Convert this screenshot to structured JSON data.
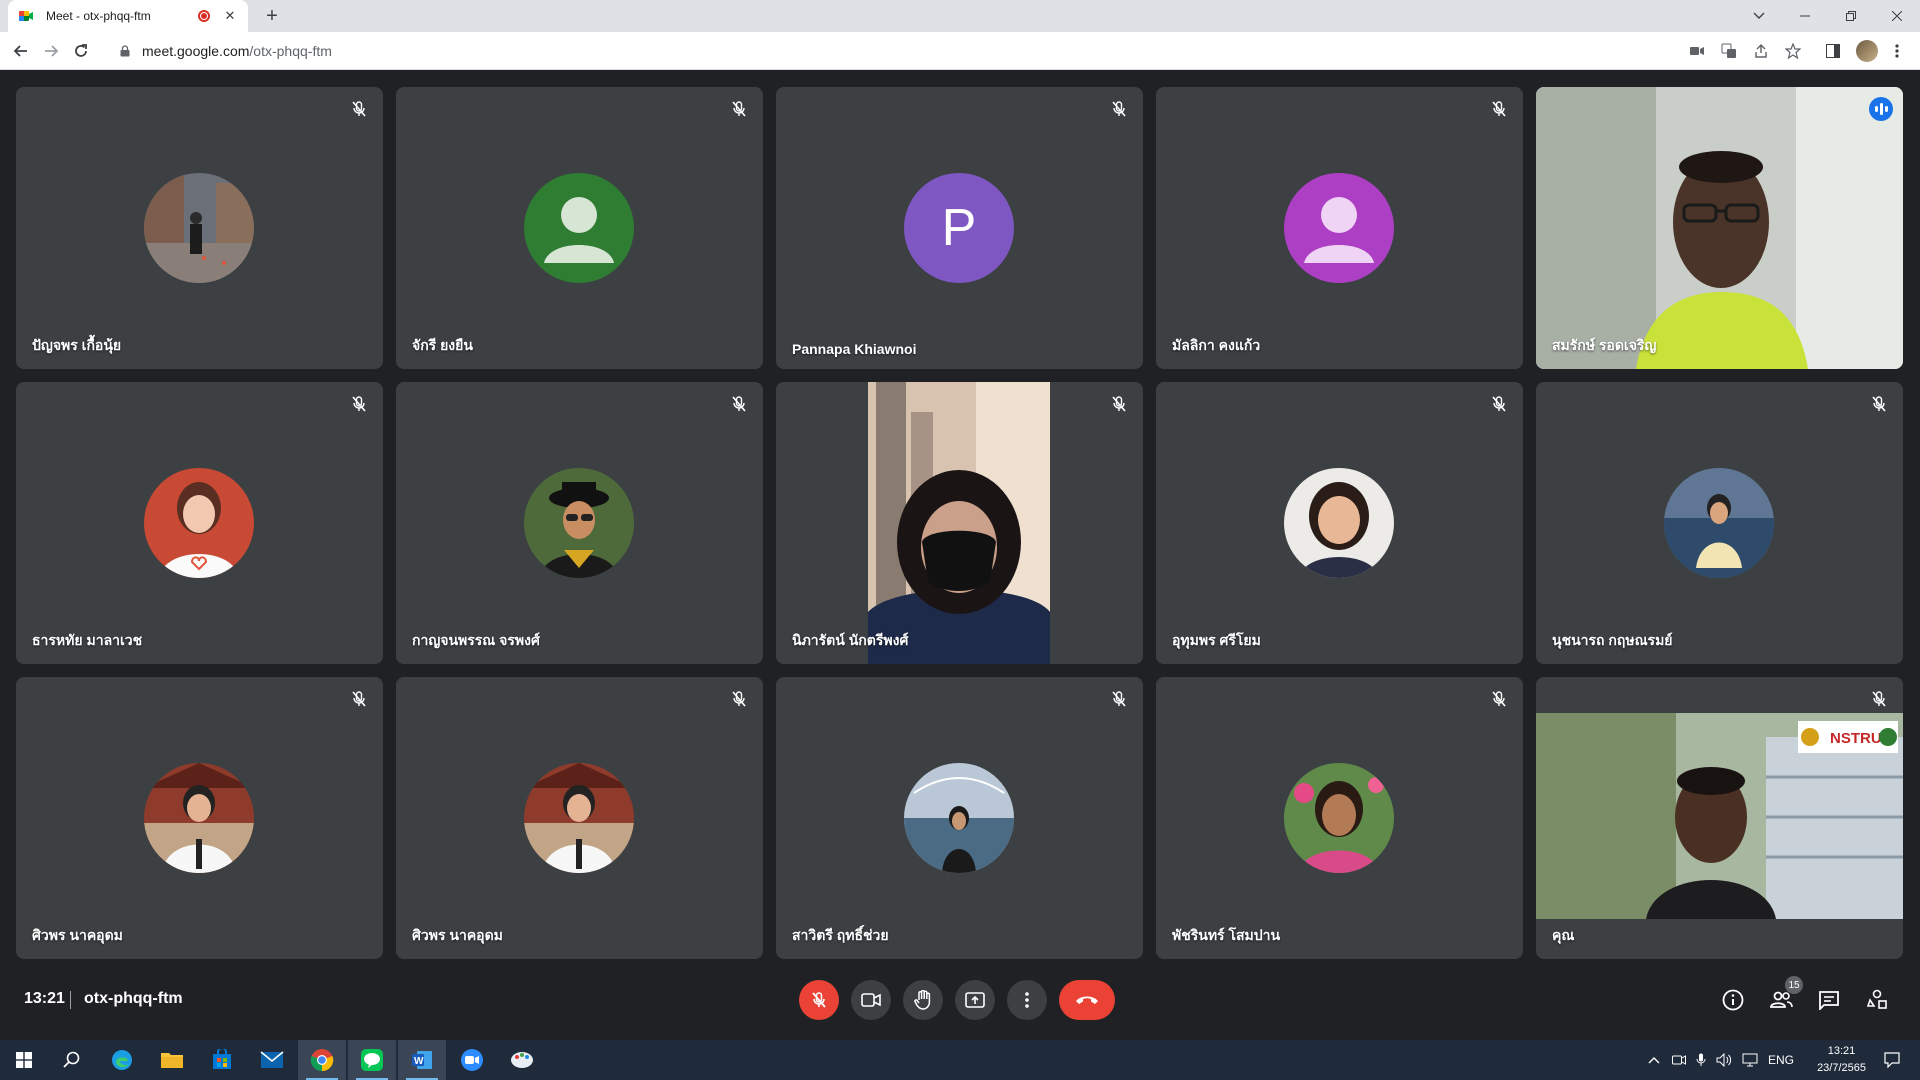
{
  "browser": {
    "tab_title": "Meet - otx-phqq-ftm",
    "url_host": "meet.google.com",
    "url_path": "/otx-phqq-ftm"
  },
  "participants": [
    {
      "name": "ปัญจพร เกื้อนุ้ย",
      "avatar": "photo",
      "muted": true
    },
    {
      "name": "จักรี ยงยืน",
      "avatar": "generic-green",
      "muted": true
    },
    {
      "name": "Pannapa Khiawnoi",
      "avatar": "letter",
      "letter": "P",
      "muted": true
    },
    {
      "name": "มัลลิกา คงแก้ว",
      "avatar": "generic-magenta",
      "muted": true
    },
    {
      "name": "สมรักษ์ รอดเจริญ",
      "avatar": "video",
      "muted": false,
      "speaking": true
    },
    {
      "name": "ธารหทัย มาลาเวช",
      "avatar": "photo",
      "muted": true
    },
    {
      "name": "กาญจนพรรณ จรพงศ์",
      "avatar": "photo",
      "muted": true
    },
    {
      "name": "นิภารัตน์ นักตรีพงศ์",
      "avatar": "video",
      "muted": true
    },
    {
      "name": "อุทุมพร ศรีโยม",
      "avatar": "photo",
      "muted": true
    },
    {
      "name": "นุชนารถ กฤษณรมย์",
      "avatar": "photo",
      "muted": true
    },
    {
      "name": "ศิวพร นาคอุดม",
      "avatar": "photo",
      "muted": true
    },
    {
      "name": "ศิวพร นาคอุดม",
      "avatar": "photo",
      "muted": true
    },
    {
      "name": "สาวิตรี ฤทธิ์ช่วย",
      "avatar": "photo",
      "muted": true
    },
    {
      "name": "พัชรินทร์ โสมปาน",
      "avatar": "photo",
      "muted": true
    },
    {
      "name": "คุณ",
      "avatar": "video",
      "muted": true,
      "overlay_text": "NSTRU"
    }
  ],
  "meeting": {
    "time": "13:21",
    "code": "otx-phqq-ftm",
    "people_count": "15"
  },
  "taskbar": {
    "lang": "ENG",
    "time": "13:21",
    "date": "23/7/2565"
  },
  "colors": {
    "background": "#202124",
    "tile": "#3c4043",
    "speaking_border": "#8ab4f8",
    "danger": "#ea4335"
  }
}
